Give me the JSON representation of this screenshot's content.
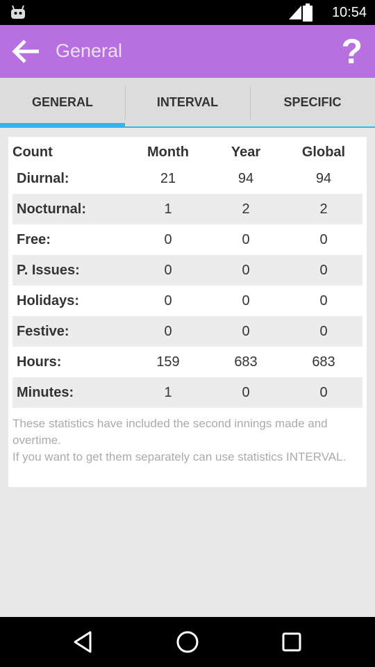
{
  "status_bar": {
    "time": "10:54"
  },
  "action_bar": {
    "title": "General",
    "help": "?"
  },
  "tabs": [
    {
      "label": "GENERAL",
      "active": true
    },
    {
      "label": "INTERVAL",
      "active": false
    },
    {
      "label": "SPECIFIC",
      "active": false
    }
  ],
  "table": {
    "headers": [
      "Count",
      "Month",
      "Year",
      "Global"
    ],
    "rows": [
      {
        "label": "Diurnal:",
        "month": "21",
        "year": "94",
        "global": "94"
      },
      {
        "label": "Nocturnal:",
        "month": "1",
        "year": "2",
        "global": "2"
      },
      {
        "label": "Free:",
        "month": "0",
        "year": "0",
        "global": "0"
      },
      {
        "label": "P. Issues:",
        "month": "0",
        "year": "0",
        "global": "0"
      },
      {
        "label": "Holidays:",
        "month": "0",
        "year": "0",
        "global": "0"
      },
      {
        "label": "Festive:",
        "month": "0",
        "year": "0",
        "global": "0"
      },
      {
        "label": "Hours:",
        "month": "159",
        "year": "683",
        "global": "683"
      },
      {
        "label": "Minutes:",
        "month": "1",
        "year": "0",
        "global": "0"
      }
    ]
  },
  "note": {
    "line1": "These statistics have included the second innings made and overtime.",
    "line2": "If you want to get them separately can use statistics INTERVAL."
  },
  "colors": {
    "action_bar": "#b86fe0",
    "tab_indicator": "#33b5e5"
  },
  "icons": [
    "android-icon",
    "signal-icon",
    "battery-icon",
    "back-arrow-icon",
    "help-icon",
    "nav-back-icon",
    "nav-home-icon",
    "nav-recents-icon"
  ]
}
